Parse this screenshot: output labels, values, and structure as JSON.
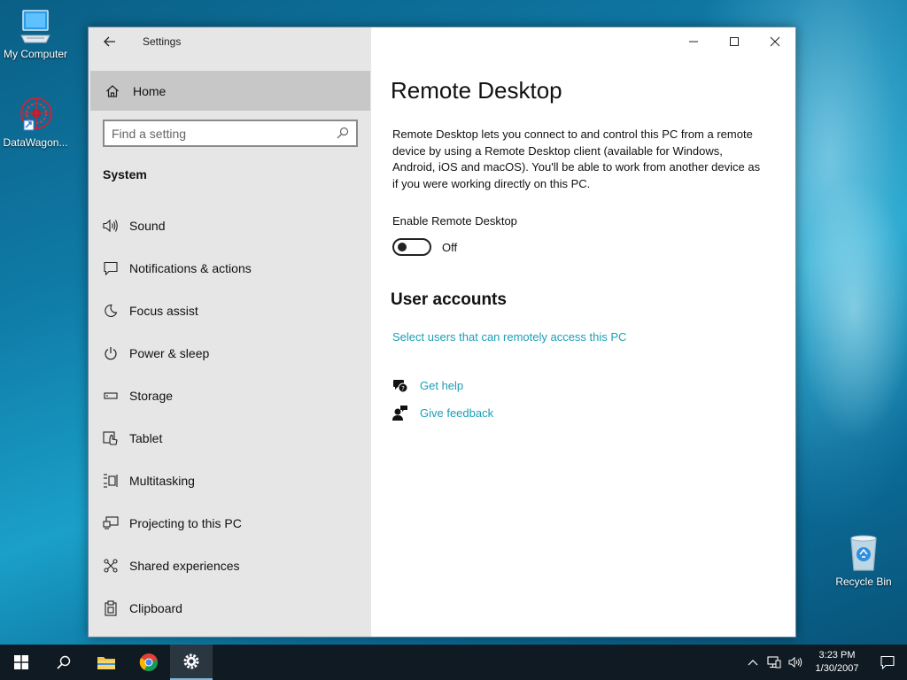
{
  "desktop": {
    "icons": [
      {
        "label": "My Computer"
      },
      {
        "label": "DataWagon..."
      },
      {
        "label": "Recycle Bin"
      }
    ]
  },
  "window": {
    "title": "Settings",
    "sidebar": {
      "home_label": "Home",
      "search_placeholder": "Find a setting",
      "section_label": "System",
      "items": [
        {
          "label": "Sound",
          "icon": "speaker-icon"
        },
        {
          "label": "Notifications & actions",
          "icon": "notification-icon"
        },
        {
          "label": "Focus assist",
          "icon": "moon-icon"
        },
        {
          "label": "Power & sleep",
          "icon": "power-icon"
        },
        {
          "label": "Storage",
          "icon": "storage-icon"
        },
        {
          "label": "Tablet",
          "icon": "tablet-icon"
        },
        {
          "label": "Multitasking",
          "icon": "multitasking-icon"
        },
        {
          "label": "Projecting to this PC",
          "icon": "projecting-icon"
        },
        {
          "label": "Shared experiences",
          "icon": "shared-icon"
        },
        {
          "label": "Clipboard",
          "icon": "clipboard-icon"
        }
      ]
    },
    "main": {
      "title": "Remote Desktop",
      "description": "Remote Desktop lets you connect to and control this PC from a remote device by using a Remote Desktop client (available for Windows, Android, iOS and macOS). You'll be able to work from another device as if you were working directly on this PC.",
      "toggle_label": "Enable Remote Desktop",
      "toggle_state": "Off",
      "user_accounts_title": "User accounts",
      "select_users_link": "Select users that can remotely access this PC",
      "get_help": "Get help",
      "give_feedback": "Give feedback"
    }
  },
  "taskbar": {
    "time": "3:23 PM",
    "date": "1/30/2007"
  },
  "colors": {
    "accent_link": "#1a9fb5",
    "sidebar_bg": "#e6e6e6",
    "home_selected_bg": "#c7c7c7",
    "taskbar_bg": "#0f1a22"
  }
}
